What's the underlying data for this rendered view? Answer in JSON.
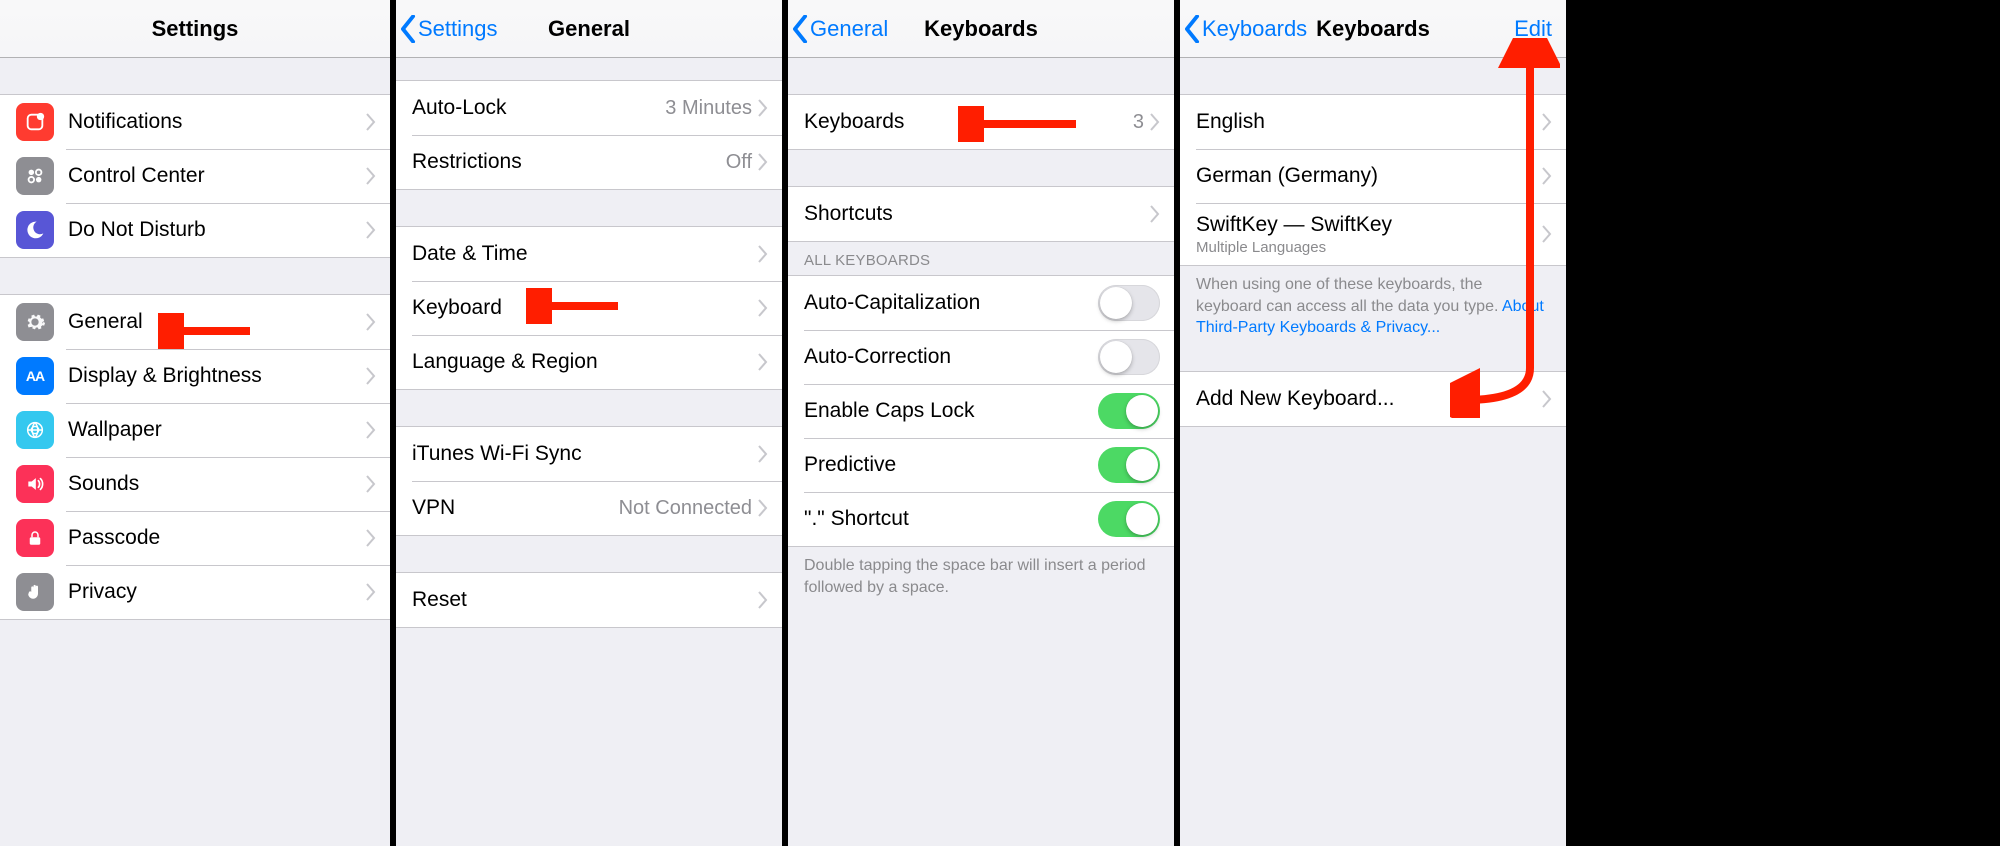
{
  "panes": {
    "settings": {
      "title": "Settings",
      "items_a": [
        {
          "label": "Notifications",
          "icon": "notifications"
        },
        {
          "label": "Control Center",
          "icon": "controlcenter"
        },
        {
          "label": "Do Not Disturb",
          "icon": "dnd"
        }
      ],
      "items_b": [
        {
          "label": "General",
          "icon": "general"
        },
        {
          "label": "Display & Brightness",
          "icon": "display"
        },
        {
          "label": "Wallpaper",
          "icon": "wallpaper"
        },
        {
          "label": "Sounds",
          "icon": "sounds"
        },
        {
          "label": "Passcode",
          "icon": "passcode"
        },
        {
          "label": "Privacy",
          "icon": "privacy"
        }
      ]
    },
    "general": {
      "back": "Settings",
      "title": "General",
      "g1": [
        {
          "label": "Auto-Lock",
          "value": "3 Minutes"
        },
        {
          "label": "Restrictions",
          "value": "Off"
        }
      ],
      "g2": [
        {
          "label": "Date & Time"
        },
        {
          "label": "Keyboard"
        },
        {
          "label": "Language & Region"
        }
      ],
      "g3": [
        {
          "label": "iTunes Wi-Fi Sync"
        },
        {
          "label": "VPN",
          "value": "Not Connected"
        }
      ],
      "g4": [
        {
          "label": "Reset"
        }
      ]
    },
    "keyboards": {
      "back": "General",
      "title": "Keyboards",
      "top": {
        "label": "Keyboards",
        "value": "3"
      },
      "shortcuts": {
        "label": "Shortcuts"
      },
      "section_header": "ALL KEYBOARDS",
      "toggles": [
        {
          "label": "Auto-Capitalization",
          "on": false
        },
        {
          "label": "Auto-Correction",
          "on": false
        },
        {
          "label": "Enable Caps Lock",
          "on": true
        },
        {
          "label": "Predictive",
          "on": true
        },
        {
          "label": "\".\" Shortcut",
          "on": true
        }
      ],
      "footer": "Double tapping the space bar will insert a period followed by a space."
    },
    "kb_list": {
      "back": "Keyboards",
      "title": "Keyboards",
      "action": "Edit",
      "items": [
        {
          "label": "English"
        },
        {
          "label": "German (Germany)"
        },
        {
          "label": "SwiftKey — SwiftKey",
          "sub": "Multiple Languages"
        }
      ],
      "footer_text": "When using one of these keyboards, the keyboard can access all the data you type.",
      "footer_link": "About Third-Party Keyboards & Privacy...",
      "add": "Add New Keyboard..."
    }
  }
}
